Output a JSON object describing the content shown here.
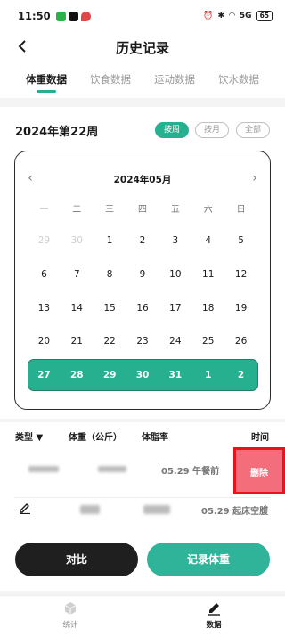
{
  "status_bar": {
    "time": "11:50",
    "signal_text": "5G",
    "battery": "65"
  },
  "header": {
    "title": "历史记录"
  },
  "tabs": [
    {
      "label": "体重数据",
      "active": true
    },
    {
      "label": "饮食数据",
      "active": false
    },
    {
      "label": "运动数据",
      "active": false
    },
    {
      "label": "饮水数据",
      "active": false
    }
  ],
  "week": {
    "title": "2024年第22周",
    "modes": [
      {
        "label": "按周",
        "active": true
      },
      {
        "label": "按月",
        "active": false
      },
      {
        "label": "全部",
        "active": false
      }
    ]
  },
  "calendar": {
    "month": "2024年05月",
    "weekdays": [
      "一",
      "二",
      "三",
      "四",
      "五",
      "六",
      "日"
    ],
    "weeks": [
      [
        "29",
        "30",
        "1",
        "2",
        "3",
        "4",
        "5"
      ],
      [
        "6",
        "7",
        "8",
        "9",
        "10",
        "11",
        "12"
      ],
      [
        "13",
        "14",
        "15",
        "16",
        "17",
        "18",
        "19"
      ],
      [
        "20",
        "21",
        "22",
        "23",
        "24",
        "25",
        "26"
      ],
      [
        "27",
        "28",
        "29",
        "30",
        "31",
        "1",
        "2"
      ]
    ]
  },
  "records": {
    "columns": {
      "type": "类型 ▼",
      "weight": "体重（公斤）",
      "fat": "体脂率",
      "time": "时间"
    },
    "rows": [
      {
        "time": "05.29 午餐前",
        "delete_label": "删除"
      },
      {
        "time": "05.29 起床空腹"
      }
    ]
  },
  "actions": {
    "compare": "对比",
    "record": "记录体重"
  },
  "bottom_nav": [
    {
      "label": "统计",
      "icon": "cube-icon"
    },
    {
      "label": "数据",
      "icon": "pencil-icon"
    }
  ],
  "colors": {
    "accent": "#27b08f",
    "delete": "#f36d7b",
    "dark": "#1f1f1f"
  }
}
